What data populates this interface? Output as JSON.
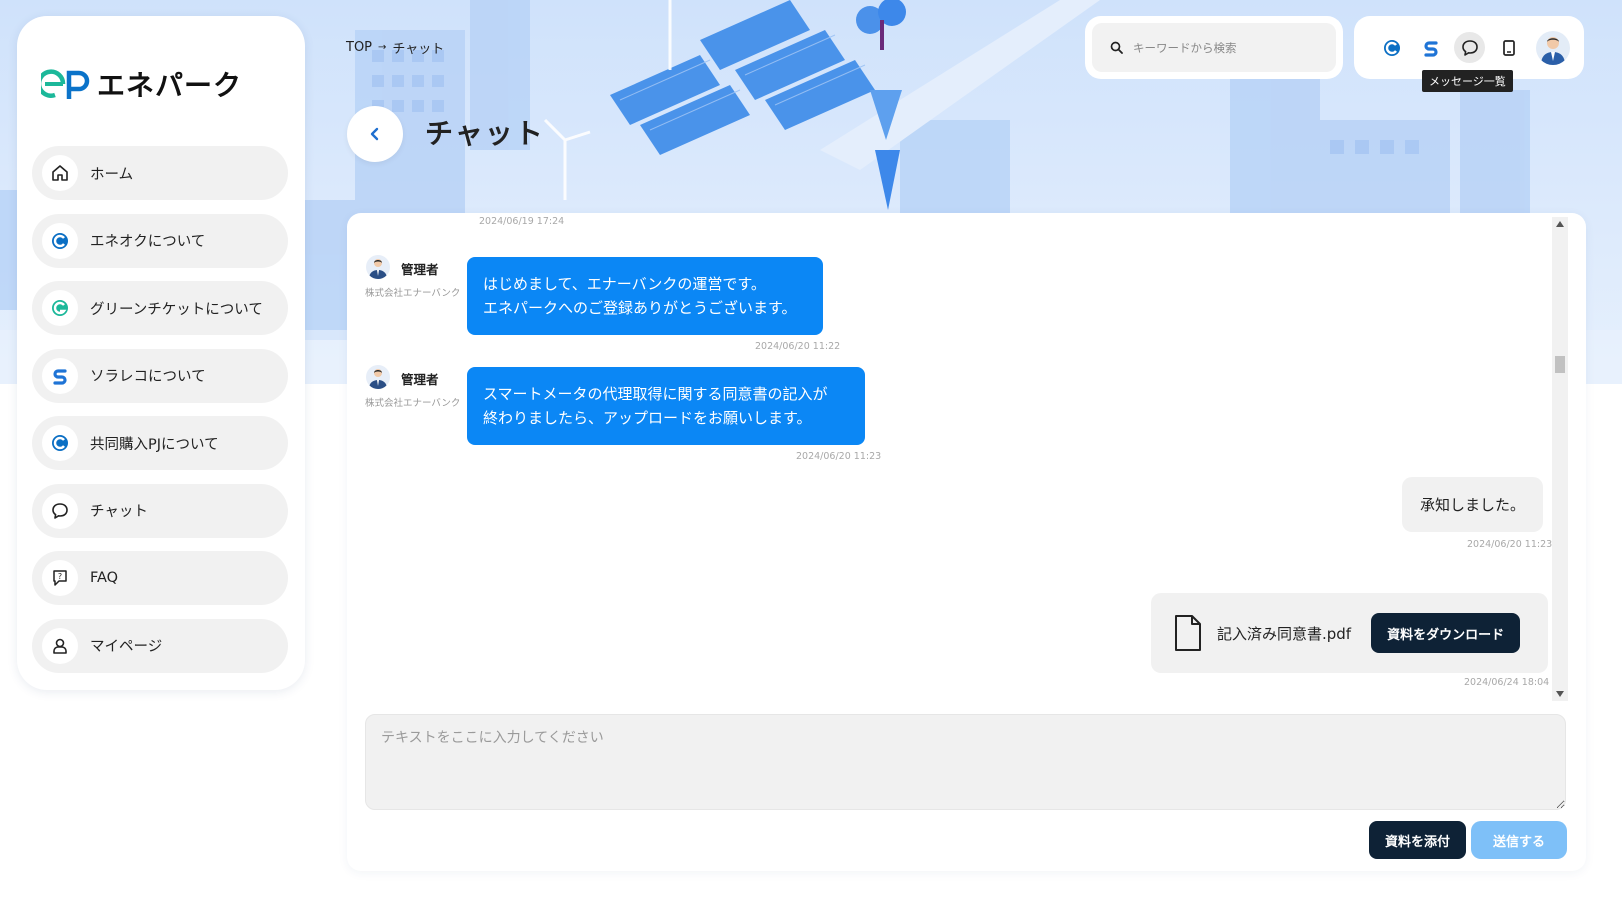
{
  "brand": {
    "name": "エネパーク",
    "accent": "#0b87f5",
    "dark": "#0e2236",
    "logo_green": "#1cb89a"
  },
  "sidebar": {
    "items": [
      {
        "label": "ホーム",
        "icon": "home-icon"
      },
      {
        "label": "エネオクについて",
        "icon": "eneoku-logo-icon"
      },
      {
        "label": "グリーンチケットについて",
        "icon": "green-ticket-logo-icon"
      },
      {
        "label": "ソラレコについて",
        "icon": "solareco-logo-icon"
      },
      {
        "label": "共同購入PJについて",
        "icon": "joint-purchase-logo-icon"
      },
      {
        "label": "チャット",
        "icon": "chat-icon"
      },
      {
        "label": "FAQ",
        "icon": "faq-icon"
      },
      {
        "label": "マイページ",
        "icon": "user-icon"
      }
    ]
  },
  "breadcrumb": {
    "home": "TOP",
    "separator": "→",
    "current": "チャット"
  },
  "page": {
    "title": "チャット"
  },
  "header": {
    "search_placeholder": "キーワードから検索",
    "tooltip": "メッセージ一覧",
    "icons": [
      "eneoku-logo-icon",
      "solareco-logo-icon",
      "chat-icon",
      "tablet-icon",
      "avatar"
    ]
  },
  "chat": {
    "top_timestamp": "2024/06/19 17:24",
    "messages": [
      {
        "direction": "in",
        "sender": "管理者",
        "company": "株式会社エナーバンク",
        "text": "はじめまして、エナーバンクの運営です。\nエネパークへのご登録ありがとうございます。",
        "timestamp": "2024/06/20 11:22"
      },
      {
        "direction": "in",
        "sender": "管理者",
        "company": "株式会社エナーバンク",
        "text": "スマートメータの代理取得に関する同意書の記入が\n終わりましたら、アップロードをお願いします。",
        "timestamp": "2024/06/20 11:23"
      },
      {
        "direction": "out",
        "text": "承知しました。",
        "timestamp": "2024/06/20 11:23"
      },
      {
        "direction": "out",
        "type": "file",
        "file_name": "記入済み同意書.pdf",
        "download_label": "資料をダウンロード",
        "timestamp": "2024/06/24 18:04"
      }
    ],
    "input_placeholder": "テキストをここに入力してください",
    "attach_label": "資料を添付",
    "send_label": "送信する"
  }
}
